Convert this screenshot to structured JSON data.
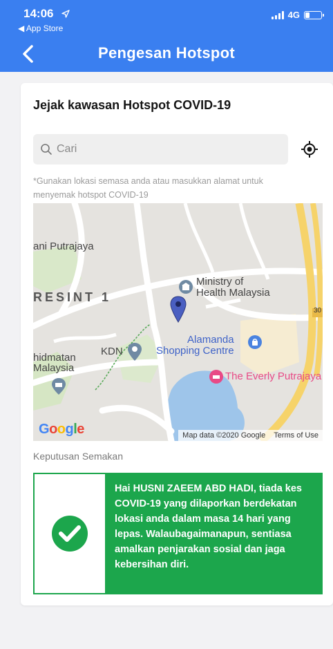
{
  "status_bar": {
    "time": "14:06",
    "back_label": "◀ App Store",
    "network": "4G"
  },
  "nav": {
    "title": "Pengesan Hotspot"
  },
  "card": {
    "title": "Jejak kawasan Hotspot COVID-19",
    "search_placeholder": "Cari",
    "hint": "*Gunakan lokasi semasa anda atau masukkan alamat untuk menyemak hotspot COVID-19"
  },
  "map": {
    "labels": {
      "putrajaya": "ani Putrajaya",
      "presint": "RESINT 1",
      "ministry": "Ministry of\nHealth Malaysia",
      "kdn": "KDN",
      "khidmatan": "hidmatan\nMalaysia",
      "alamanda": "Alamanda\nShopping Centre",
      "everly": "The Everly Putrajaya",
      "road_number": "30"
    },
    "google_logo": "Google",
    "map_data": "Map data ©2020 Google",
    "terms": "Terms of Use"
  },
  "result": {
    "section_label": "Keputusan Semakan",
    "message": "Hai HUSNI ZAEEM ABD HADI, tiada kes COVID-19 yang dilaporkan berdekatan lokasi anda dalam masa 14 hari yang lepas. Walaubagaimanapun, sentiasa amalkan penjarakan sosial dan jaga kebersihan diri."
  },
  "colors": {
    "header_blue": "#3a7ff0",
    "success_green": "#1ca64c"
  }
}
